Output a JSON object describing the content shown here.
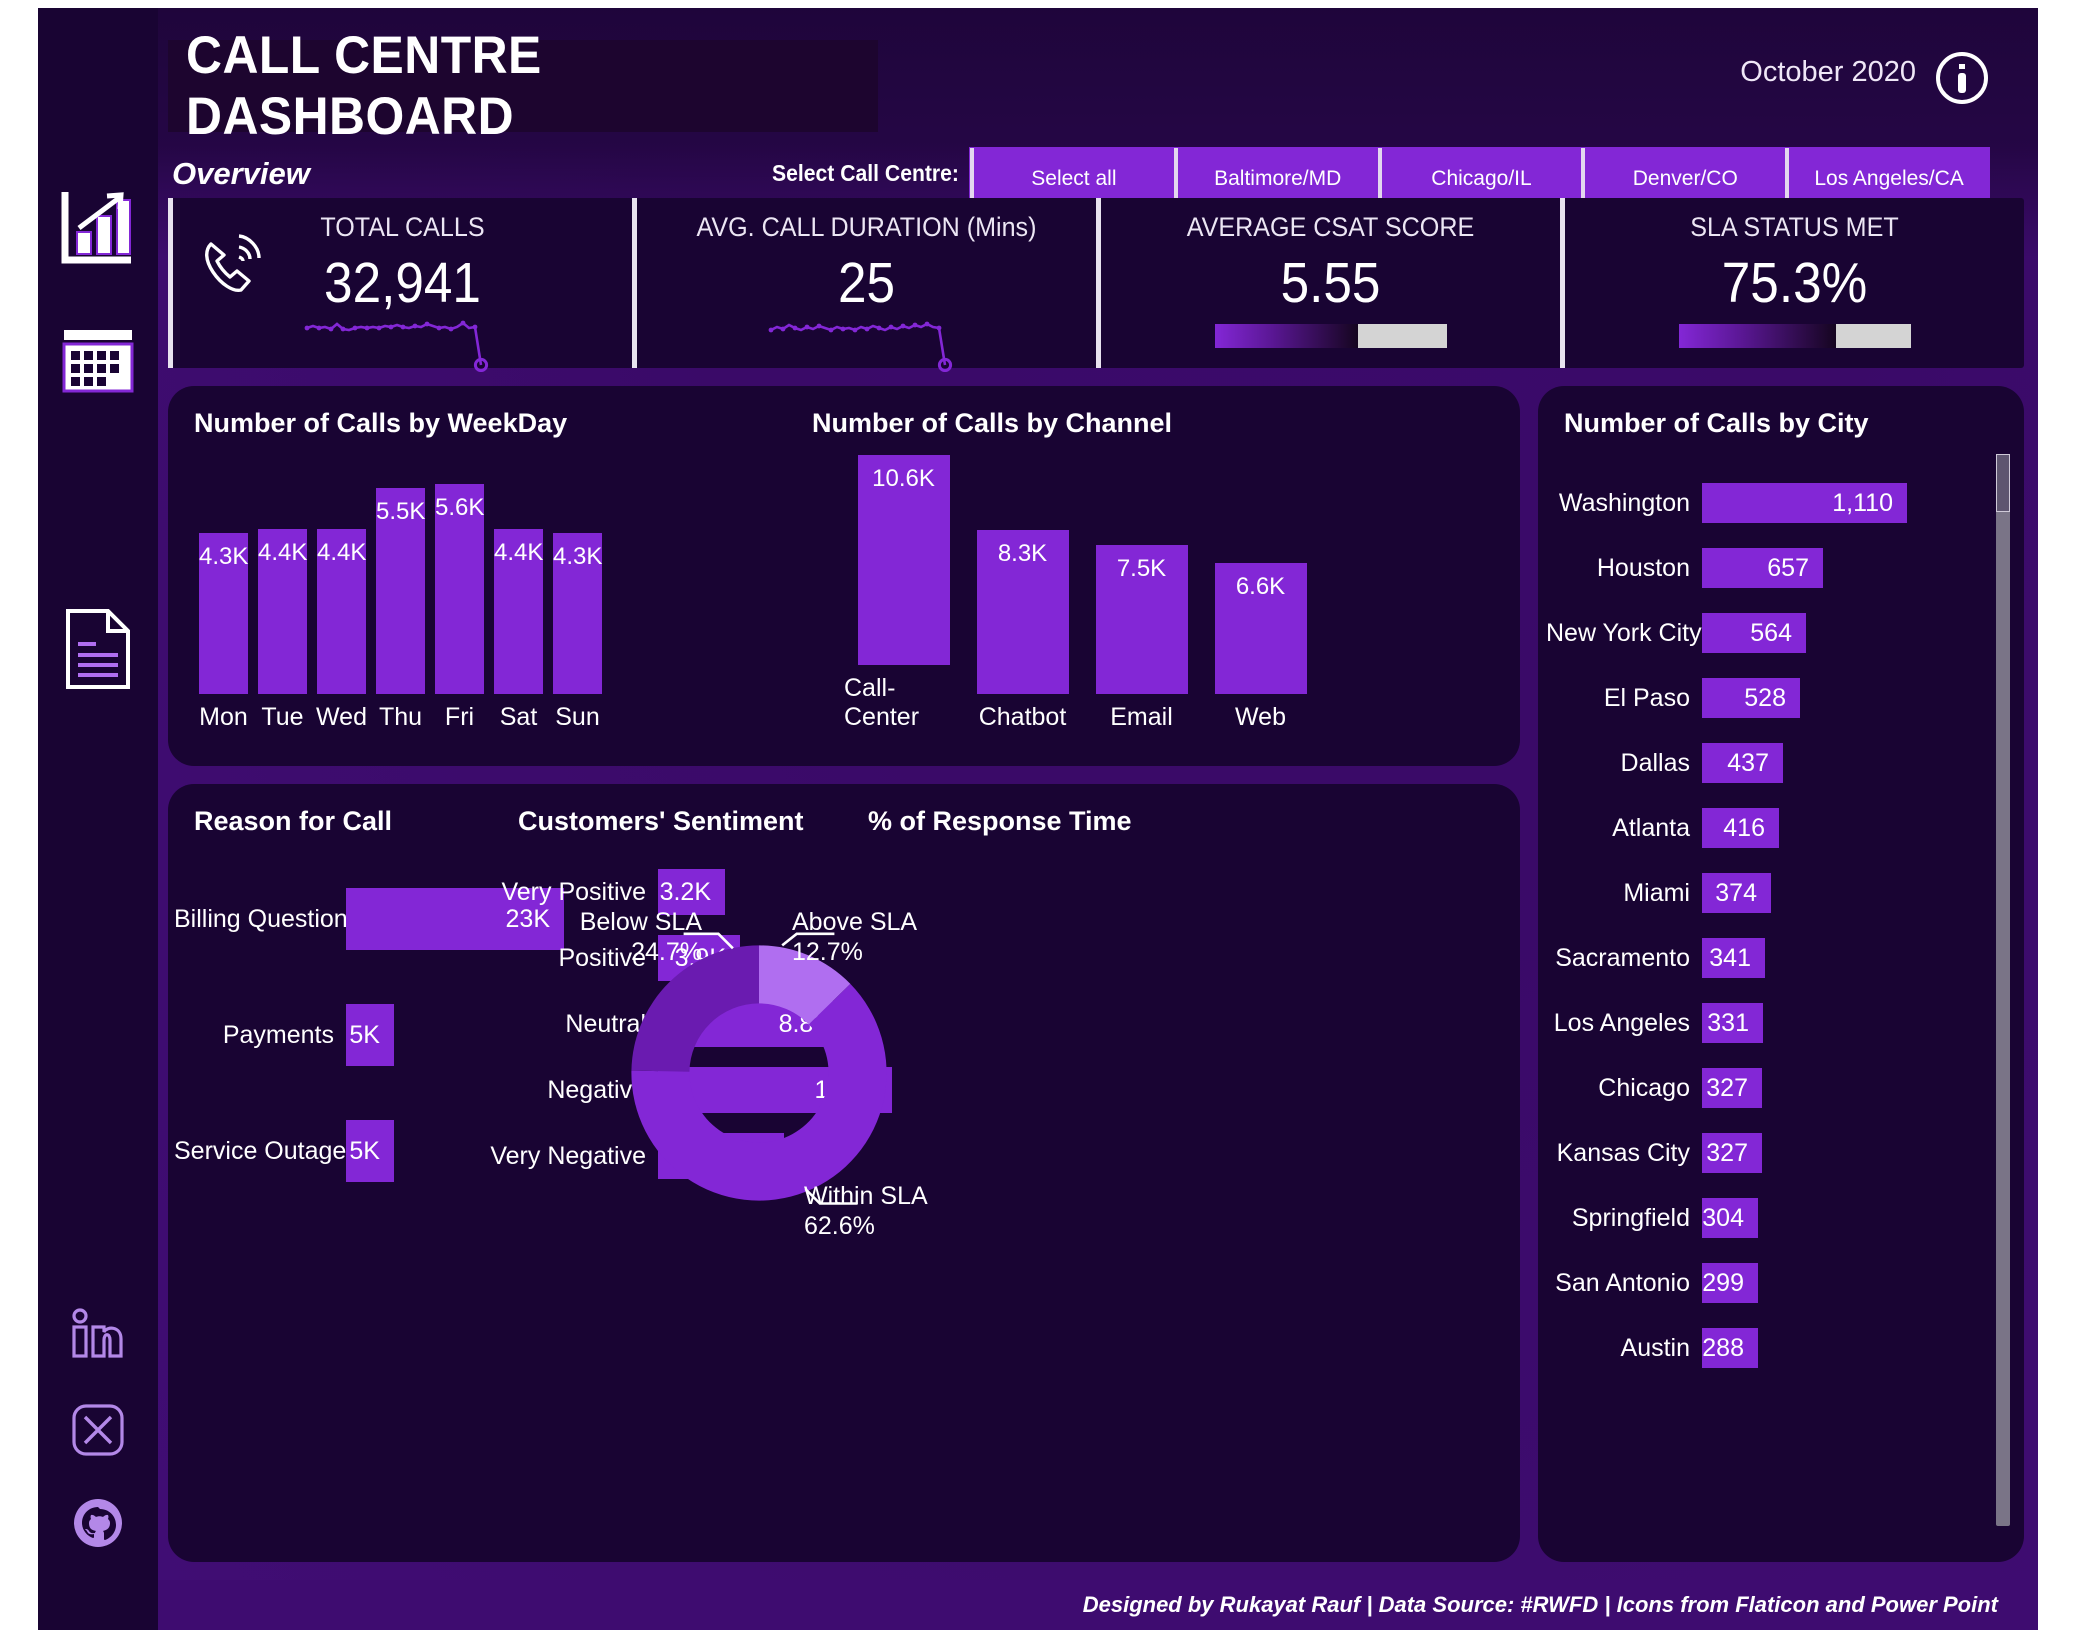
{
  "header": {
    "title": "CALL CENTRE DASHBOARD",
    "month": "October 2020",
    "page_label": "Overview",
    "info_icon": "info-icon"
  },
  "slicer": {
    "label": "Select Call Centre:",
    "options": [
      "Select all",
      "Baltimore/MD",
      "Chicago/IL",
      "Denver/CO",
      "Los Angeles/CA"
    ]
  },
  "kpis": [
    {
      "title": "TOTAL CALLS",
      "value": "32,941",
      "visual": "sparkline"
    },
    {
      "title": "AVG. CALL DURATION (Mins)",
      "value": "25",
      "visual": "sparkline"
    },
    {
      "title": "AVERAGE CSAT SCORE",
      "value": "5.55",
      "visual": "bar",
      "fill_pct": 62
    },
    {
      "title": "SLA STATUS MET",
      "value": "75.3%",
      "visual": "bar",
      "fill_pct": 68
    }
  ],
  "sidebar": {
    "items": [
      {
        "icon": "growth-chart-icon",
        "name": "overview-page"
      },
      {
        "icon": "calendar-grid-icon",
        "name": "calendar-page"
      },
      {
        "icon": "document-icon",
        "name": "document-page"
      }
    ],
    "social": [
      {
        "icon": "linkedin-icon"
      },
      {
        "icon": "x-twitter-icon"
      },
      {
        "icon": "github-icon"
      }
    ]
  },
  "colors": {
    "page_background": "#3e0c70",
    "card_background": "#190433",
    "accent_purple": "#8327d6",
    "accent_light": "#b06ef0",
    "accent_dark": "#6a1bb0",
    "text": "#ffffff"
  },
  "footer": {
    "text": "Designed by Rukayat Rauf | Data Source: #RWFD | Icons from Flaticon and Power Point"
  },
  "chart_data": [
    {
      "type": "bar",
      "title": "Number of Calls by WeekDay",
      "orientation": "vertical",
      "categories": [
        "Mon",
        "Tue",
        "Wed",
        "Thu",
        "Fri",
        "Sat",
        "Sun"
      ],
      "values": [
        4300,
        4400,
        4400,
        5500,
        5600,
        4400,
        4300
      ],
      "labels": [
        "4.3K",
        "4.4K",
        "4.4K",
        "5.5K",
        "5.6K",
        "4.4K",
        "4.3K"
      ],
      "xlabel": "",
      "ylabel": "",
      "ylim": [
        0,
        5600
      ],
      "grid": false,
      "legend": "none"
    },
    {
      "type": "bar",
      "title": "Number of Calls by Channel",
      "orientation": "vertical",
      "categories": [
        "Call-Center",
        "Chatbot",
        "Email",
        "Web"
      ],
      "values": [
        10600,
        8300,
        7500,
        6600
      ],
      "labels": [
        "10.6K",
        "8.3K",
        "7.5K",
        "6.6K"
      ],
      "xlabel": "",
      "ylabel": "",
      "ylim": [
        0,
        10600
      ],
      "grid": false,
      "legend": "none"
    },
    {
      "type": "bar",
      "title": "Number of Calls by City",
      "orientation": "horizontal",
      "categories": [
        "Washington",
        "Houston",
        "New York City",
        "El Paso",
        "Dallas",
        "Atlanta",
        "Miami",
        "Sacramento",
        "Los Angeles",
        "Chicago",
        "Kansas City",
        "Springfield",
        "San Antonio",
        "Austin"
      ],
      "values": [
        1110,
        657,
        564,
        528,
        437,
        416,
        374,
        341,
        331,
        327,
        327,
        304,
        299,
        288
      ],
      "labels": [
        "1,110",
        "657",
        "564",
        "528",
        "437",
        "416",
        "374",
        "341",
        "331",
        "327",
        "327",
        "304",
        "299",
        "288"
      ],
      "xlabel": "",
      "ylabel": "",
      "xlim": [
        0,
        1110
      ],
      "grid": false,
      "legend": "none"
    },
    {
      "type": "bar",
      "title": "Reason for Call",
      "orientation": "horizontal",
      "categories": [
        "Billing Question",
        "Payments",
        "Service Outage"
      ],
      "values": [
        23000,
        5000,
        5000
      ],
      "labels": [
        "23K",
        "5K",
        "5K"
      ],
      "xlabel": "",
      "ylabel": "",
      "xlim": [
        0,
        23000
      ],
      "grid": false,
      "legend": "none"
    },
    {
      "type": "bar",
      "title": "Customers' Sentiment",
      "orientation": "horizontal",
      "categories": [
        "Very Positive",
        "Positive",
        "Neutral",
        "Negative",
        "Very Negative"
      ],
      "values": [
        3200,
        3900,
        8800,
        11100,
        6000
      ],
      "labels": [
        "3.2K",
        "3.9K",
        "8.8K",
        "11.1K",
        "6.0K"
      ],
      "xlabel": "",
      "ylabel": "",
      "xlim": [
        0,
        11100
      ],
      "grid": false,
      "legend": "none"
    },
    {
      "type": "pie",
      "subtype": "donut",
      "title": "% of Response Time",
      "categories": [
        "Above SLA",
        "Within SLA",
        "Below SLA"
      ],
      "values": [
        12.7,
        62.6,
        24.7
      ],
      "labels": [
        "12.7%",
        "62.6%",
        "24.7%"
      ],
      "slice_colors": [
        "#b06ef0",
        "#8327d6",
        "#6a1bb0"
      ],
      "legend": "callout-labels"
    }
  ]
}
